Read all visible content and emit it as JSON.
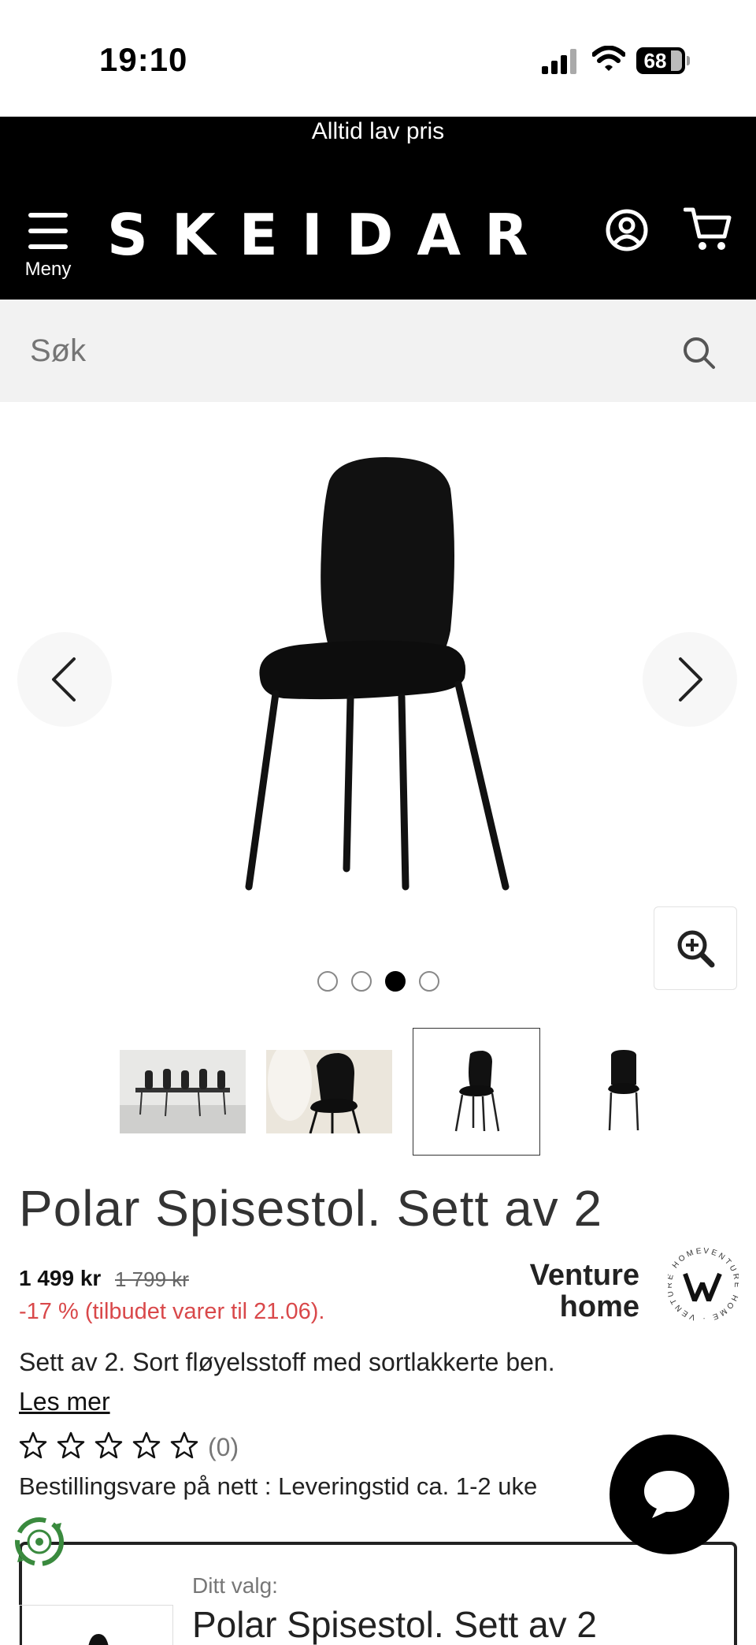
{
  "status_bar": {
    "time": "19:10",
    "battery": "68"
  },
  "header": {
    "promo": "Alltid lav pris",
    "menu_label": "Meny",
    "logo": "SKEIDAR"
  },
  "search": {
    "placeholder": "Søk"
  },
  "gallery": {
    "dots": 4,
    "active_dot": 3
  },
  "product": {
    "title": "Polar Spisestol. Sett av 2",
    "price_now": "1 499 kr",
    "price_old": "1 799 kr",
    "discount": "-17 % (tilbudet varer til 21.06).",
    "brand": "Venture home",
    "brand_line1": "Venture",
    "brand_line2": "home",
    "brand_seal_text": "VENTURE HOME",
    "description": "Sett av 2. Sort fløyelsstoff med sortlakkerte ben.",
    "read_more": "Les mer",
    "rating": 0,
    "review_count": "(0)",
    "delivery": "Bestillingsvare på nett : Leveringstid ca. 1-2 uke"
  },
  "choice": {
    "label": "Ditt valg:",
    "title": "Polar Spisestol. Sett av 2"
  },
  "colors": {
    "header_bg": "#000000",
    "discount": "#d9484a",
    "search_bg": "#f2f2f2"
  }
}
